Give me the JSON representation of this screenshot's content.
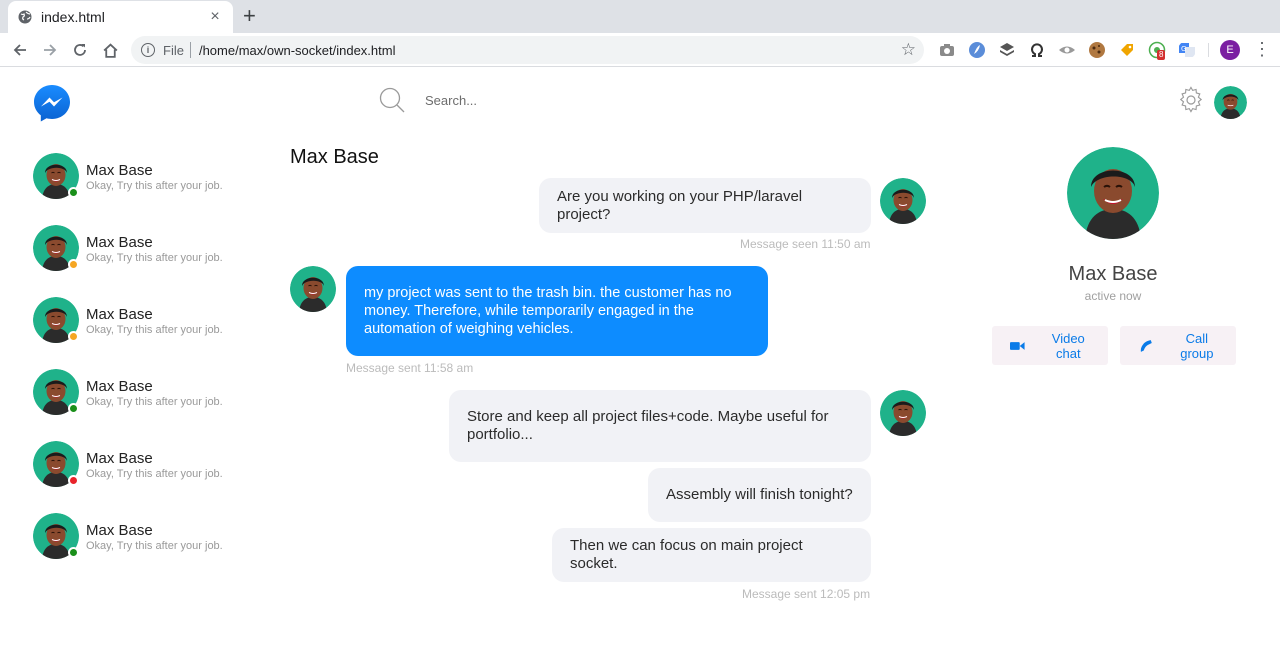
{
  "browser": {
    "tab_title": "index.html",
    "new_tab": "+",
    "close": "×",
    "scheme": "File",
    "url": "/home/max/own-socket/index.html",
    "profile_initial": "E",
    "ext_badge": "8"
  },
  "app": {
    "search_placeholder": "Search...",
    "contacts": [
      {
        "name": "Max Base",
        "preview": "Okay, Try this after your job.",
        "status_color": "#1a8f1a"
      },
      {
        "name": "Max Base",
        "preview": "Okay, Try this after your job.",
        "status_color": "#f5a623"
      },
      {
        "name": "Max Base",
        "preview": "Okay, Try this after your job.",
        "status_color": "#f5a623"
      },
      {
        "name": "Max Base",
        "preview": "Okay, Try this after your job.",
        "status_color": "#1a8f1a"
      },
      {
        "name": "Max Base",
        "preview": "Okay, Try this after your job.",
        "status_color": "#e8232a"
      },
      {
        "name": "Max Base",
        "preview": "Okay, Try this after your job.",
        "status_color": "#1a8f1a"
      }
    ],
    "conversation": {
      "title": "Max Base",
      "messages": [
        {
          "text": "Are you working on your PHP/laravel project?",
          "direction": "in"
        },
        {
          "meta": "Message seen 11:50 am"
        },
        {
          "text": "my project was sent to the trash bin. the customer has no money. Therefore, while temporarily engaged in the automation of weighing vehicles.",
          "direction": "out"
        },
        {
          "meta": "Message sent 11:58 am"
        },
        {
          "text": "Store and keep all project files+code. Maybe useful for portfolio...",
          "direction": "in"
        },
        {
          "text": "Assembly will finish tonight?",
          "direction": "in"
        },
        {
          "text": "Then we can focus on main project socket.",
          "direction": "in"
        },
        {
          "meta": "Message sent 12:05 pm"
        }
      ]
    },
    "profile": {
      "name": "Max Base",
      "status": "active now",
      "video_label": "Video chat",
      "call_label": "Call group"
    },
    "colors": {
      "accent": "#0d8cff",
      "messenger_blue": "#0a7be8",
      "avatar_bg": "#1fb28a"
    }
  }
}
